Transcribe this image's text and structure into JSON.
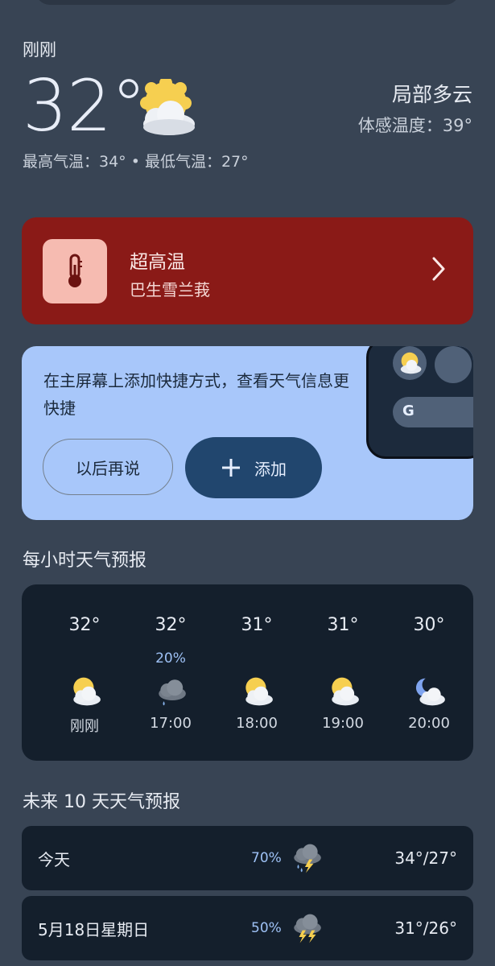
{
  "current": {
    "updated_label": "刚刚",
    "temperature": "32°",
    "condition": "局部多云",
    "feels_like": "体感温度：39°",
    "high_low": "最高气温：34° • 最低气温：27°",
    "icon": "partly-cloudy-sun-icon"
  },
  "alert": {
    "title": "超高温",
    "location": "巴生雪兰莪",
    "icon": "thermometer-icon",
    "color": "#8a1a17"
  },
  "promo": {
    "text": "在主屏幕上添加快捷方式，查看天气信息更快捷",
    "later_label": "以后再说",
    "add_label": "添加",
    "google_letter": "G"
  },
  "hourly": {
    "title": "每小时天气预报",
    "items": [
      {
        "temp": "32°",
        "prob": "",
        "time": "刚刚",
        "icon": "partly-cloudy-sun-icon"
      },
      {
        "temp": "32°",
        "prob": "20%",
        "time": "17:00",
        "icon": "rain-cloud-icon"
      },
      {
        "temp": "31°",
        "prob": "",
        "time": "18:00",
        "icon": "partly-cloudy-sun-icon"
      },
      {
        "temp": "31°",
        "prob": "",
        "time": "19:00",
        "icon": "partly-cloudy-sun-icon"
      },
      {
        "temp": "30°",
        "prob": "",
        "time": "20:00",
        "icon": "partly-cloudy-moon-icon"
      }
    ]
  },
  "daily": {
    "title": "未来 10 天天气预报",
    "items": [
      {
        "day": "今天",
        "prob": "70%",
        "temps": "34°/27°",
        "icon": "thunderstorm-rain-icon"
      },
      {
        "day": "5月18日星期日",
        "prob": "50%",
        "temps": "31°/26°",
        "icon": "thunderstorm-icon"
      }
    ]
  }
}
